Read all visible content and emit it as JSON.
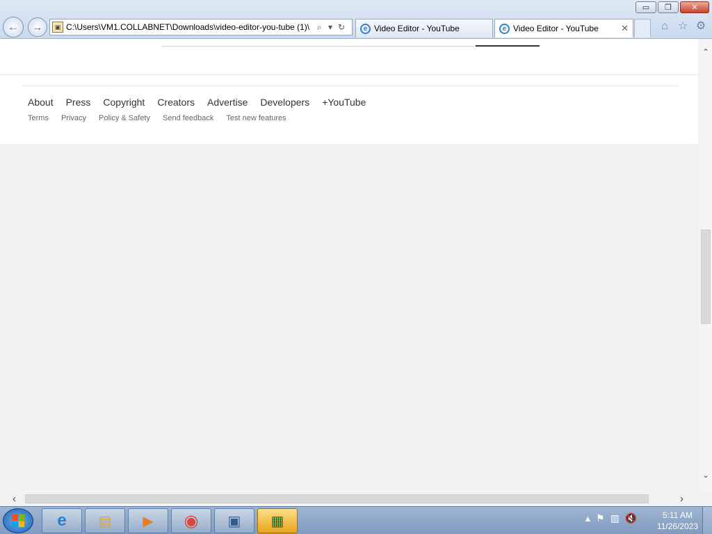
{
  "window": {
    "minimize": "▭",
    "restore": "❐",
    "close": "✕"
  },
  "nav": {
    "back": "←",
    "forward": "→"
  },
  "address": {
    "url": "C:\\Users\\VM1.COLLABNET\\Downloads\\video-editor-you-tube (1)\\",
    "search_glyph": "⌕",
    "dropdown_glyph": "▾",
    "refresh_glyph": "↻"
  },
  "tabs": [
    {
      "label": "Video Editor - YouTube",
      "active": false
    },
    {
      "label": "Video Editor - YouTube",
      "active": true
    }
  ],
  "tab_close": "✕",
  "toolbar": {
    "home": "⌂",
    "favorites": "☆",
    "settings": "⚙"
  },
  "footer": {
    "primary_links": [
      "About",
      "Press",
      "Copyright",
      "Creators",
      "Advertise",
      "Developers",
      "+YouTube"
    ],
    "secondary_links": [
      "Terms",
      "Privacy",
      "Policy & Safety",
      "Send feedback",
      "Test new features"
    ]
  },
  "scroll": {
    "up": "⌃",
    "down": "⌄",
    "left": "‹",
    "right": "›"
  },
  "taskbar": {
    "items": [
      {
        "name": "internet-explorer",
        "glyph": "e"
      },
      {
        "name": "file-explorer",
        "glyph": "▤"
      },
      {
        "name": "media-player",
        "glyph": "▶"
      },
      {
        "name": "chrome",
        "glyph": "◉"
      },
      {
        "name": "remote-desktop",
        "glyph": "▣"
      },
      {
        "name": "app-active",
        "glyph": "▦"
      }
    ],
    "tray_glyphs": [
      "▴",
      "⚑",
      "▥",
      "🔇"
    ],
    "time": "5:11 AM",
    "date": "11/26/2023"
  },
  "colors": {
    "accent_ie": "#2c7fd1",
    "taskbar": "#8aa5c8",
    "active_task": "#e8a317"
  }
}
